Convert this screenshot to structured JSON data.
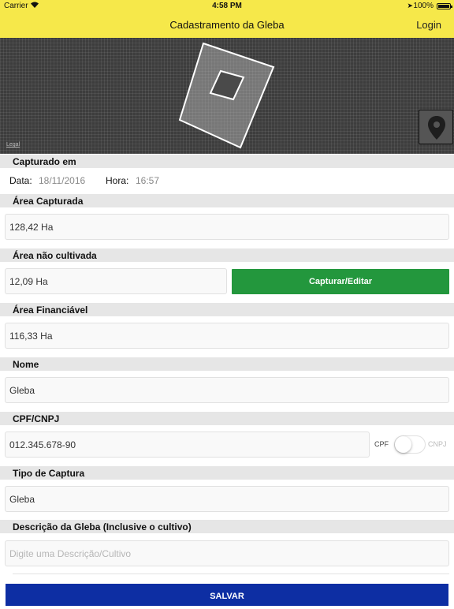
{
  "status_bar": {
    "carrier": "Carrier",
    "time": "4:58 PM",
    "battery": "100%",
    "battery_level": 1.0
  },
  "nav": {
    "title": "Cadastramento da Gleba",
    "login": "Login"
  },
  "map": {
    "legal": "Legal",
    "pin_icon": "location-pin-icon"
  },
  "captured": {
    "header": "Capturado em",
    "date_label": "Data:",
    "date_value": "18/11/2016",
    "time_label": "Hora:",
    "time_value": "16:57"
  },
  "area_captured": {
    "header": "Área Capturada",
    "value": "128,42 Ha"
  },
  "area_uncultivated": {
    "header": "Área não cultivada",
    "value": "12,09 Ha",
    "button": "Capturar/Editar"
  },
  "area_financeable": {
    "header": "Área Financiável",
    "value": "116,33 Ha"
  },
  "name": {
    "header": "Nome",
    "value": "Gleba"
  },
  "document": {
    "header": "CPF/CNPJ",
    "value": "012.345.678-90",
    "toggle_left": "CPF",
    "toggle_right": "CNPJ"
  },
  "capture_type": {
    "header": "Tipo de Captura",
    "value": "Gleba"
  },
  "description": {
    "header": "Descrição da Gleba (Inclusive o cultivo)",
    "placeholder": "Digite uma Descrição/Cultivo"
  },
  "save_button": "SALVAR",
  "colors": {
    "navbar": "#f6e84a",
    "green_button": "#23973d",
    "save_button": "#0d2ea3",
    "section_header": "#e6e6e6"
  }
}
